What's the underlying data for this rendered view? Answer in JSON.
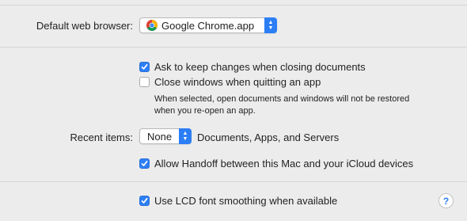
{
  "browser": {
    "label": "Default web browser:",
    "value": "Google Chrome.app",
    "icon": "chrome-icon"
  },
  "options": {
    "ask_keep_changes": {
      "label": "Ask to keep changes when closing documents",
      "checked": true
    },
    "close_windows": {
      "label": "Close windows when quitting an app",
      "checked": false
    },
    "note_line1": "When selected, open documents and windows will not be restored",
    "note_line2": "when you re-open an app."
  },
  "recent": {
    "label": "Recent items:",
    "value": "None",
    "suffix": "Documents, Apps, and Servers"
  },
  "handoff": {
    "label": "Allow Handoff between this Mac and your iCloud devices",
    "checked": true
  },
  "lcd": {
    "label": "Use LCD font smoothing when available",
    "checked": true
  },
  "help": {
    "glyph": "?"
  },
  "colors": {
    "accent": "#2c7ef5",
    "background": "#ececec"
  }
}
